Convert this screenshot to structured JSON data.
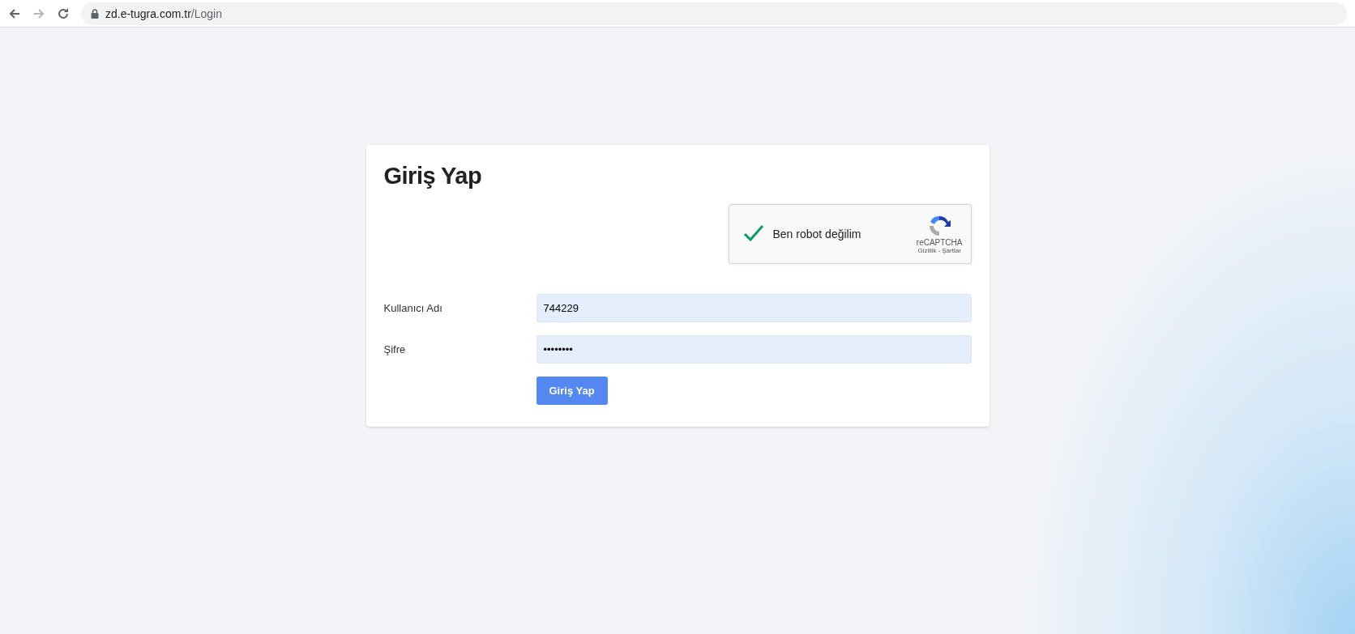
{
  "browser": {
    "url_host": "zd.e-tugra.com.tr",
    "url_path": "/Login"
  },
  "login": {
    "title": "Giriş Yap",
    "captcha": {
      "label": "Ben robot değilim",
      "checked": true,
      "brand": "reCAPTCHA",
      "privacy": "Gizlilik",
      "separator": "-",
      "terms": "Şartlar"
    },
    "fields": [
      {
        "label": "Kullanıcı Adı",
        "value": "744229"
      },
      {
        "label": "Şifre",
        "value": "••••••••"
      }
    ],
    "submit": "Giriş Yap"
  }
}
